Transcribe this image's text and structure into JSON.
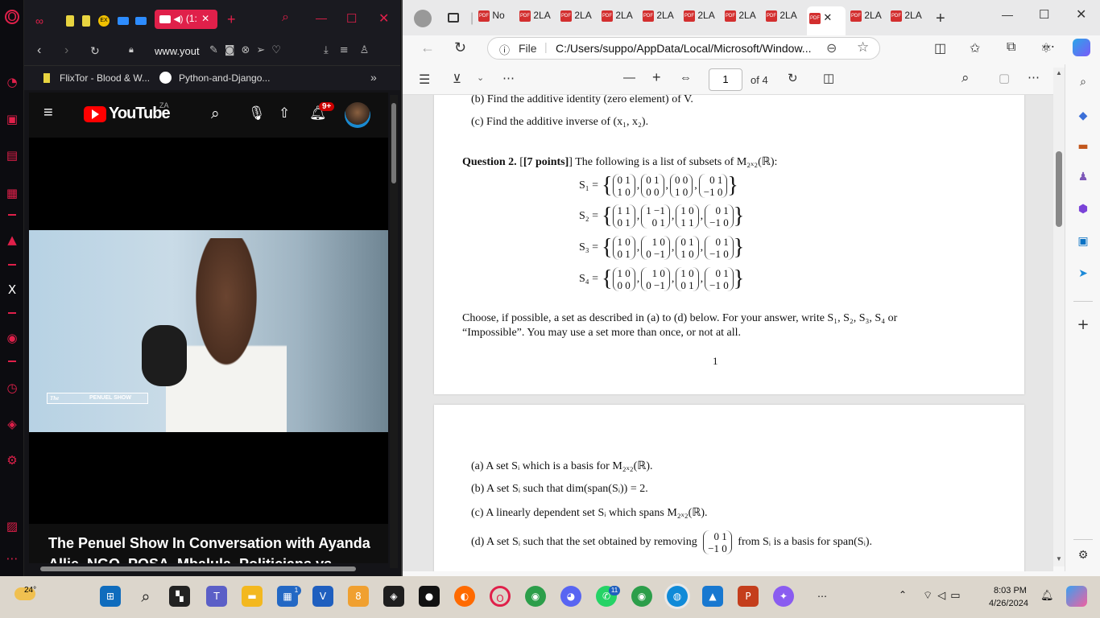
{
  "opera": {
    "active_tab": "(1:",
    "url": "www.yout",
    "bookmarks": [
      "FlixTor - Blood & W...",
      "Python-and-Django..."
    ],
    "notif_badge": "9+",
    "country": "ZA",
    "logo_text": "YouTube",
    "video_overlay": "PENUEL SHOW",
    "video_overlay_prefix": "The",
    "video_title": "The Penuel Show In Conversation with Ayanda Allie, NGO, POSA, Mbalula, Politicians vs Bureaucrats"
  },
  "edge": {
    "tabs": [
      "No",
      "2LA",
      "2LA",
      "2LA",
      "2LA",
      "2LA",
      "2LA",
      "2LA",
      "2LA",
      "2LA"
    ],
    "file_label": "File",
    "url": "C:/Users/suppo/AppData/Local/Microsoft/Window...",
    "page_input": "1",
    "page_total": "of 4"
  },
  "doc": {
    "item_b": "(b)  Find the additive identity (zero element) of V.",
    "item_c": "(c)  Find the additive inverse of (x₁, x₂).",
    "q2_head": "Question 2.",
    "q2_points": "[7 points]",
    "q2_text": "The following is a list of subsets of M₂ₓ₂(ℝ):",
    "sets": [
      {
        "label": "S₁ =",
        "mats": [
          [
            "0 1",
            "1 0"
          ],
          [
            "0 1",
            "0 0"
          ],
          [
            "0 0",
            "1 0"
          ],
          [
            "0 1",
            "−1 0"
          ]
        ]
      },
      {
        "label": "S₂ =",
        "mats": [
          [
            "1 1",
            "0 1"
          ],
          [
            "1 −1",
            "0 1"
          ],
          [
            "1 0",
            "1 1"
          ],
          [
            "0 1",
            "−1 0"
          ]
        ]
      },
      {
        "label": "S₃ =",
        "mats": [
          [
            "1 0",
            "0 1"
          ],
          [
            "1 0",
            "0 −1"
          ],
          [
            "0 1",
            "1 0"
          ],
          [
            "0 1",
            "−1 0"
          ]
        ]
      },
      {
        "label": "S₄ =",
        "mats": [
          [
            "1 0",
            "0 0"
          ],
          [
            "1 0",
            "0 −1"
          ],
          [
            "1 0",
            "0 1"
          ],
          [
            "0 1",
            "−1 0"
          ]
        ]
      }
    ],
    "choose1": "Choose, if possible, a set as described in (a) to (d) below.  For your answer, write S₁, S₂, S₃, S₄ or",
    "choose2": "“Impossible”.  You may use a set more than once, or not at all.",
    "page_num": "1",
    "part_a": "(a)  A set Sᵢ which is a basis for M₂ₓ₂(ℝ).",
    "part_b": "(b)  A set Sᵢ such that dim(span(Sᵢ)) = 2.",
    "part_c": "(c)  A linearly dependent set Sᵢ which spans M₂ₓ₂(ℝ).",
    "part_d1": "(d)  A set Sᵢ such that the set obtained by removing",
    "part_d_mat": [
      "0 1",
      "−1 0"
    ],
    "part_d2": "from Sᵢ is a basis for span(Sᵢ)."
  },
  "taskbar": {
    "temp": "24°",
    "time": "8:03 PM",
    "date": "4/26/2024",
    "badge_store": "1",
    "badge_whatsapp": "11"
  }
}
